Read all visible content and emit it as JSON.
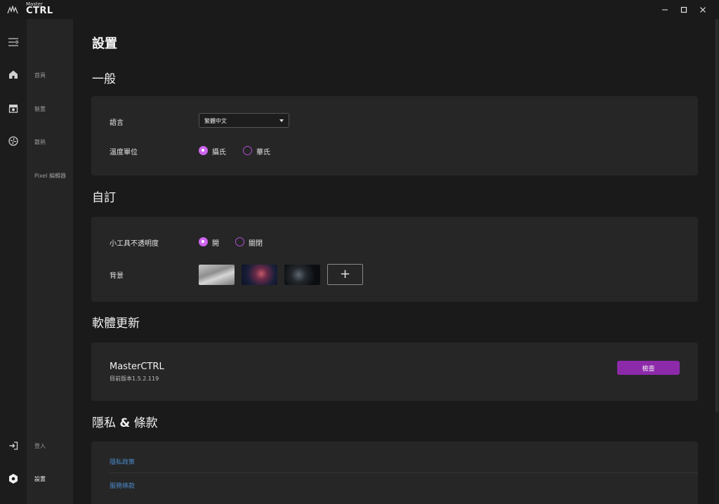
{
  "app": {
    "logo_small": "Master",
    "logo_big": "CTRL",
    "logo_icon": "mastercooler-logo-icon"
  },
  "window_controls": {
    "minimize_icon": "minimize-icon",
    "maximize_icon": "maximize-icon",
    "close_icon": "close-icon"
  },
  "rail": {
    "collapse_icon": "collapse-menu-icon",
    "items": [
      {
        "icon": "home-icon"
      },
      {
        "icon": "device-icon"
      },
      {
        "icon": "fan-icon"
      },
      {
        "icon": "login-icon"
      },
      {
        "icon": "settings-gear-icon"
      }
    ]
  },
  "sidebar": {
    "items": [
      {
        "label": "首頁"
      },
      {
        "label": "裝置"
      },
      {
        "label": "散熱"
      },
      {
        "label": "Pixel 編輯器"
      },
      {
        "label": "登入"
      },
      {
        "label": "設置"
      }
    ]
  },
  "page": {
    "title": "設置"
  },
  "general": {
    "title": "一般",
    "language_label": "語言",
    "language_value": "繁體中文",
    "temp_label": "溫度單位",
    "temp_options": [
      "攝氏",
      "華氏"
    ],
    "temp_selected": "攝氏"
  },
  "custom": {
    "title": "自訂",
    "opacity_label": "小工具不透明度",
    "opacity_options": [
      "開",
      "關閉"
    ],
    "opacity_selected": "開",
    "background_label": "背景",
    "add_label": "+"
  },
  "update": {
    "title": "軟體更新",
    "app_name": "MasterCTRL",
    "version_text": "目前版本1.5.2.119",
    "check_label": "檢查"
  },
  "privacy": {
    "title_part1": "隱私 ",
    "title_amp": "&",
    "title_part2": " 條款",
    "links": [
      "隱私政策",
      "服務條款"
    ]
  },
  "colors": {
    "accent": "#cf65f0",
    "button": "#8d2aaa",
    "link": "#4a88c7",
    "card": "#262626",
    "background": "#1a1a1a"
  }
}
